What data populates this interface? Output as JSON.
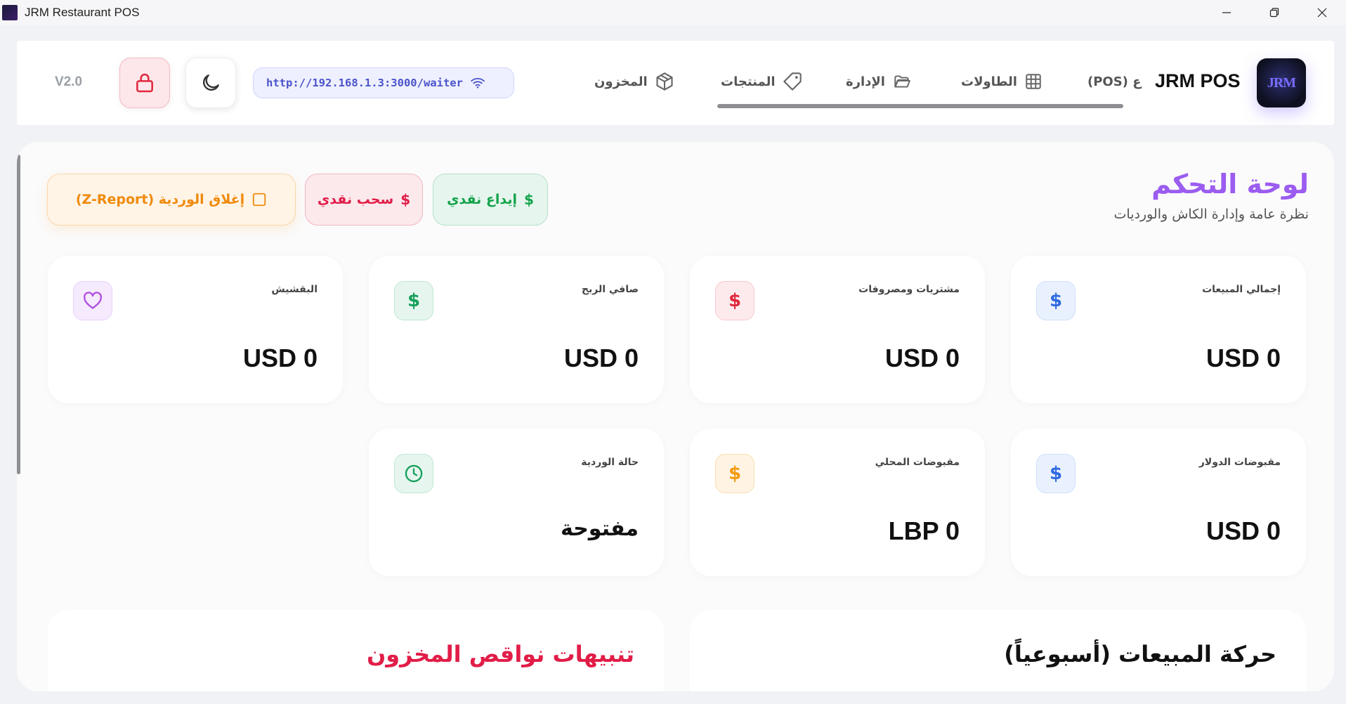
{
  "window": {
    "title": "JRM Restaurant POS"
  },
  "header": {
    "brand": "JRM POS",
    "logo_text": "JRM",
    "nav": [
      {
        "label": "(POS) ع",
        "icon": "none"
      },
      {
        "label": "الطاولات",
        "icon": "grid-icon"
      },
      {
        "label": "الإدارة",
        "icon": "folder-icon"
      },
      {
        "label": "المنتجات",
        "icon": "tag-icon"
      },
      {
        "label": "المخزون",
        "icon": "box-icon"
      }
    ],
    "waiter_url": "http://192.168.1.3:3000/waiter",
    "version": "V2.0"
  },
  "dashboard": {
    "title": "لوحة التحكم",
    "subtitle": "نظرة عامة وإدارة الكاش والورديات",
    "actions": {
      "deposit": "إيداع نقدي",
      "withdraw": "سحب نقدي",
      "close_shift": "إغلاق الوردية (Z-Report)"
    },
    "cards": [
      {
        "label": "إجمالي المبيعات",
        "value": "USD 0",
        "icon": "dollar-icon",
        "color": "#2f6be0"
      },
      {
        "label": "مشتريات ومصروفات",
        "value": "USD 0",
        "icon": "dollar-icon",
        "color": "#e0283e"
      },
      {
        "label": "صافي الربح",
        "value": "USD 0",
        "icon": "dollar-icon",
        "color": "#17a05c"
      },
      {
        "label": "البقشيش",
        "value": "USD 0",
        "icon": "heart-icon",
        "color": "#b14ee0"
      },
      {
        "label": "مقبوضات الدولار",
        "value": "USD 0",
        "icon": "dollar-icon",
        "color": "#2f6be0"
      },
      {
        "label": "مقبوضات المحلي",
        "value": "LBP 0",
        "icon": "dollar-icon",
        "color": "#f29a12"
      },
      {
        "label": "حالة الوردية",
        "value": "مفتوحة",
        "icon": "clock-icon",
        "color": "#17a05c"
      }
    ],
    "panels": {
      "sales_chart_title": "حركة المبيعات (أسبوعياً)",
      "low_stock_title": "تنبيهات نواقص المخزون"
    }
  },
  "colors": {
    "accent_purple": "#9b5cf0",
    "low_stock_red": "#e11d48",
    "deposit_green": "#14a34a",
    "close_shift_orange": "#f08a0c"
  }
}
